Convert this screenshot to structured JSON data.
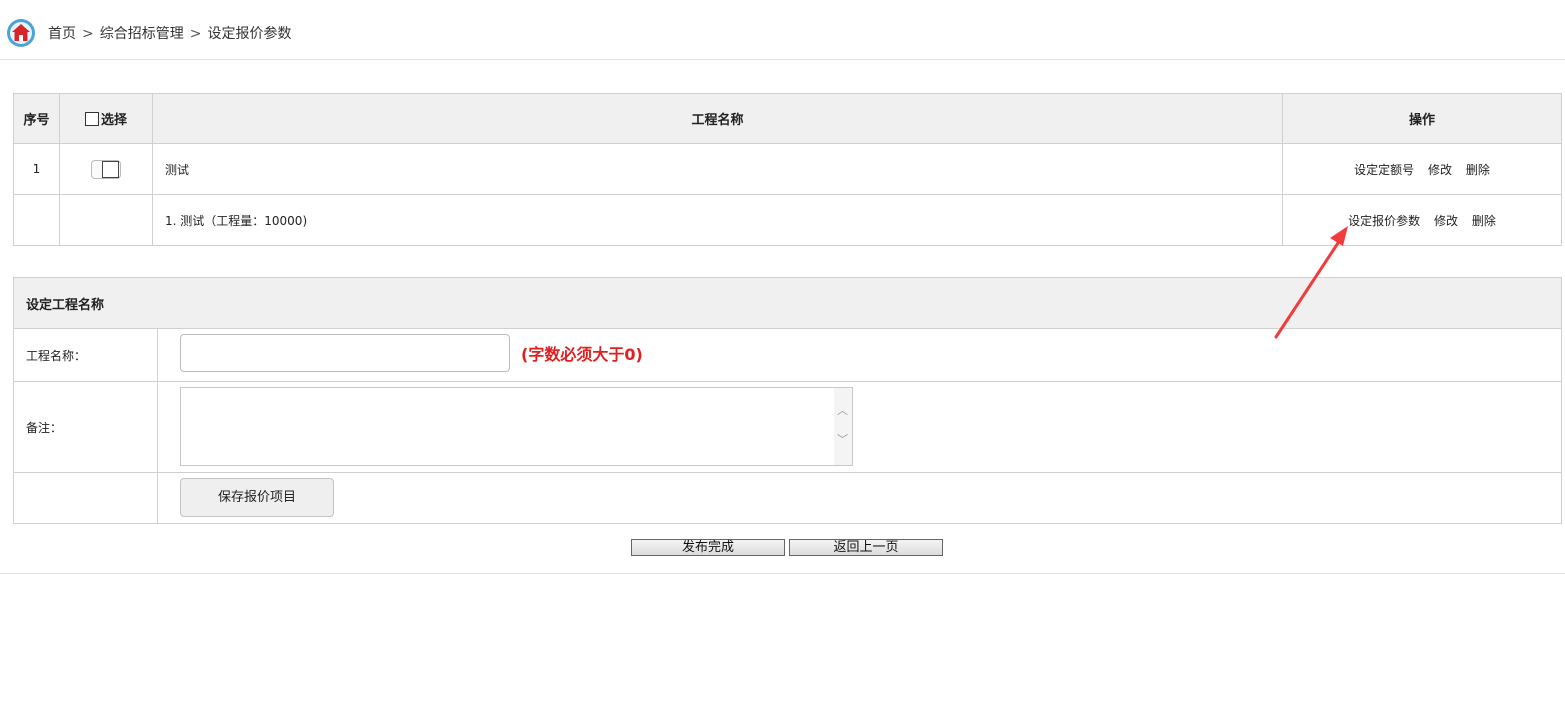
{
  "breadcrumb": {
    "home": "首页",
    "separator": ">",
    "section": "综合招标管理",
    "current": "设定报价参数"
  },
  "project_table": {
    "headers": {
      "index": "序号",
      "select": "选择",
      "name": "工程名称",
      "actions": "操作"
    },
    "rows": [
      {
        "index": "1",
        "name": "测试",
        "actions": [
          "设定定额号",
          "修改",
          "删除"
        ]
      },
      {
        "index": "",
        "name": "1. 测试（工程量：10000)",
        "actions": [
          "设定报价参数",
          "修改",
          "删除"
        ]
      }
    ]
  },
  "form": {
    "title": "设定工程名称",
    "name_label": "工程名称：",
    "name_value": "",
    "name_hint": "(字数必须大于0)",
    "remark_label": "备注：",
    "remark_value": "",
    "save_label": "保存报价项目"
  },
  "footer": {
    "publish_label": "发布完成",
    "back_label": "返回上一页"
  },
  "colors": {
    "hint": "#e02020",
    "annotation_arrow": "#f03c3c",
    "header_bg": "#f0f0f0"
  }
}
